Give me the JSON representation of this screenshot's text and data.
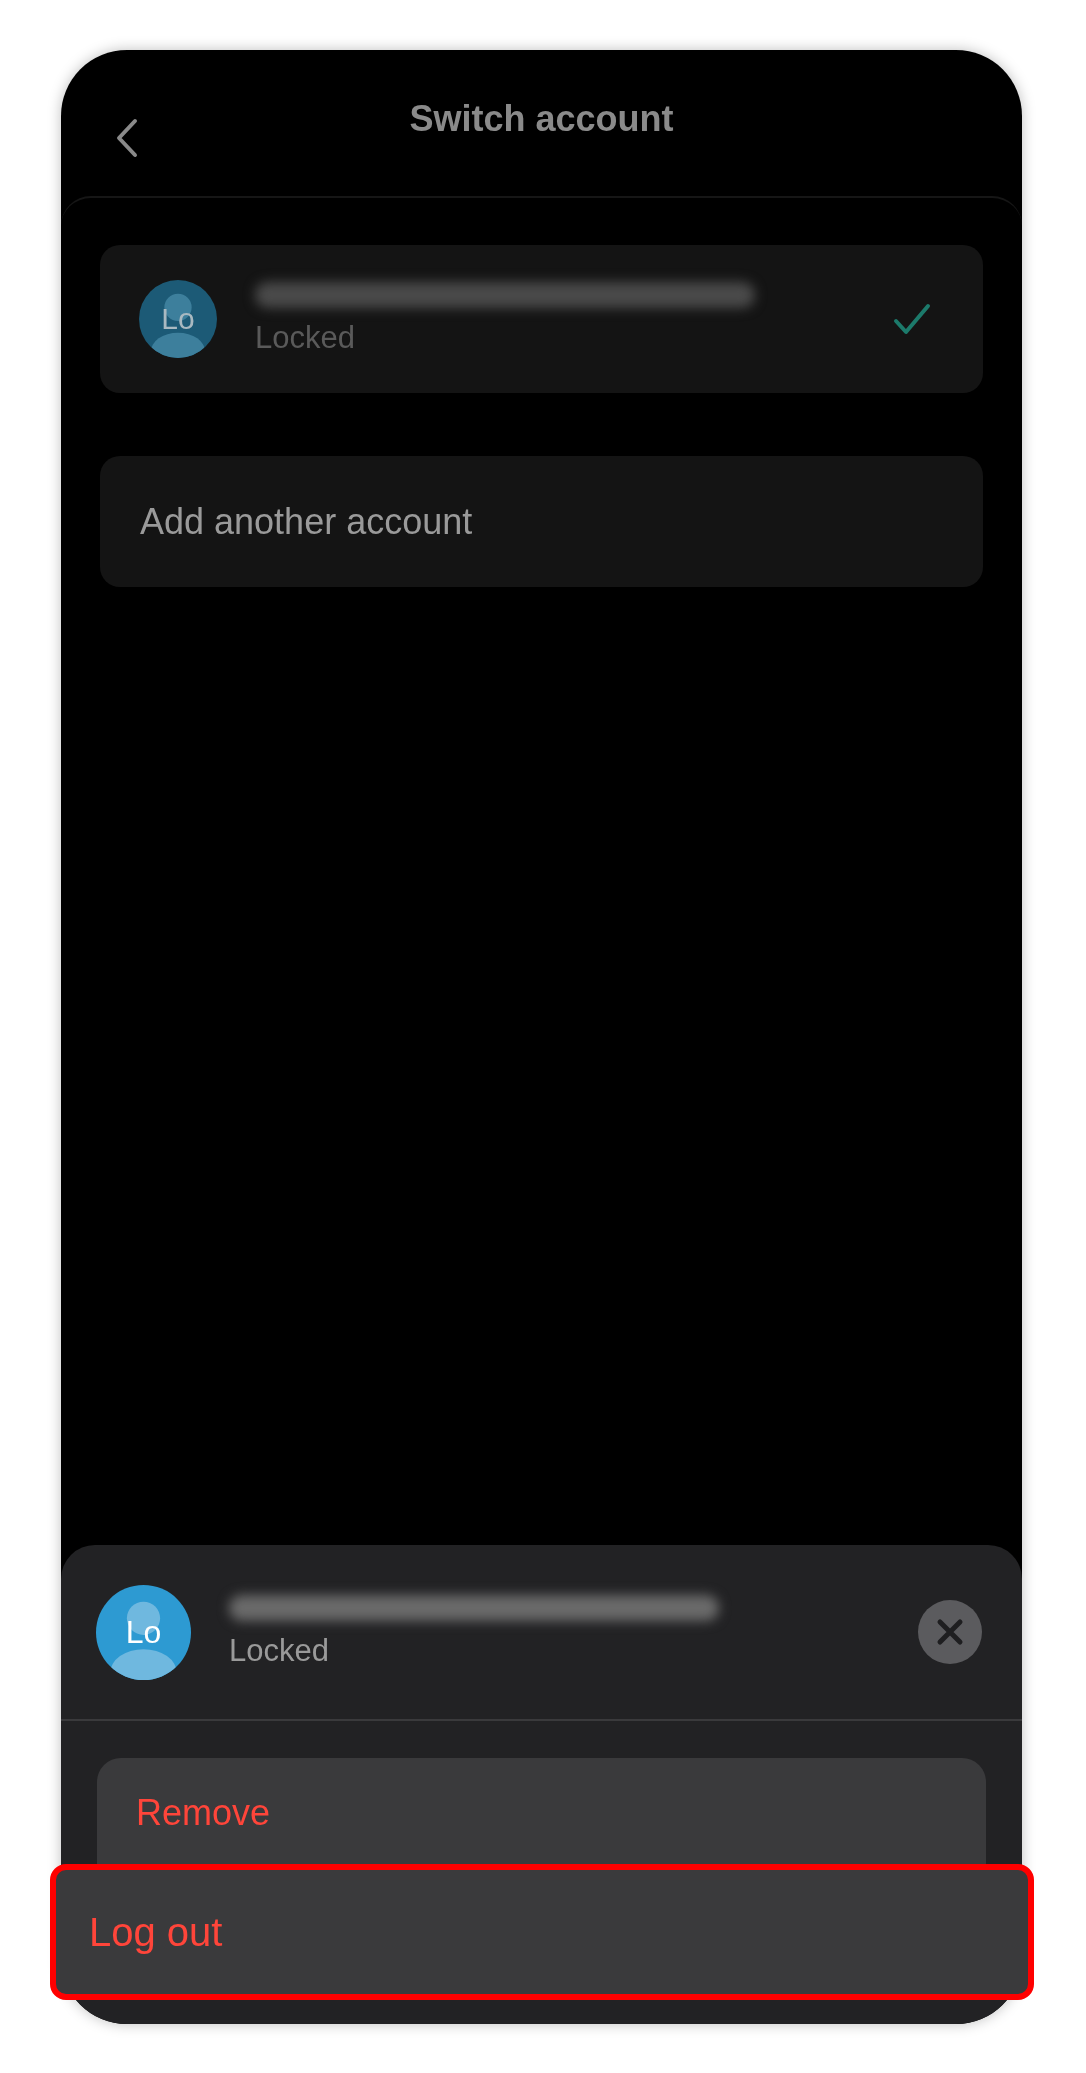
{
  "header": {
    "title": "Switch account"
  },
  "accounts": [
    {
      "initials": "Lo",
      "status": "Locked",
      "selected": true
    }
  ],
  "add_account": {
    "label": "Add another account"
  },
  "sheet": {
    "account": {
      "initials": "Lo",
      "status": "Locked"
    },
    "actions": [
      {
        "label": "Remove",
        "highlighted": false
      },
      {
        "label": "Log out",
        "highlighted": true
      }
    ]
  }
}
